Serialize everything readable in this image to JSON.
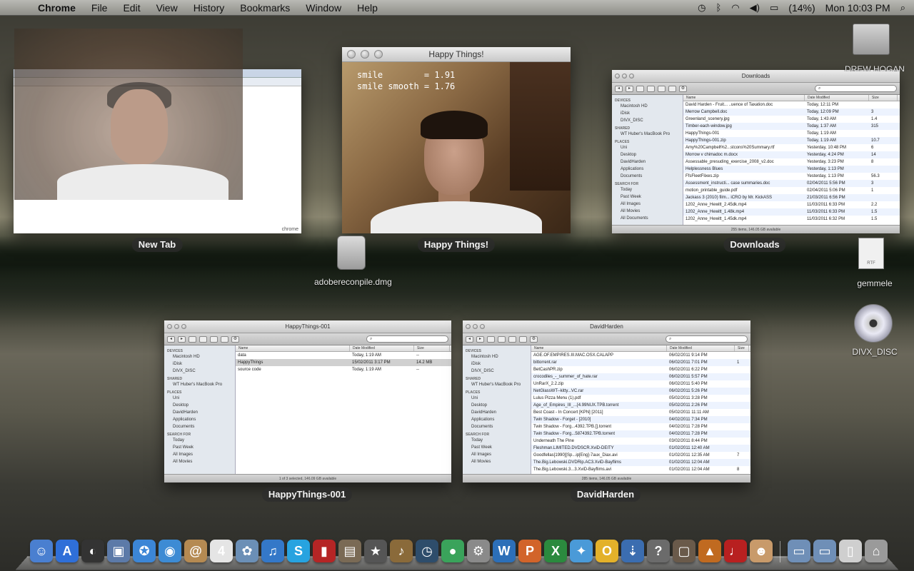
{
  "menubar": {
    "app_name": "Chrome",
    "menus": [
      "File",
      "Edit",
      "View",
      "History",
      "Bookmarks",
      "Window",
      "Help"
    ],
    "battery": "(14%)",
    "clock": "Mon 10:03 PM"
  },
  "windows": {
    "chrome": {
      "caption": "New Tab",
      "logo": "chrome"
    },
    "happy": {
      "title": "Happy Things!",
      "caption": "Happy Things!",
      "readout_line1": "smile        = 1.91",
      "readout_line2": "smile smooth = 1.76"
    },
    "downloads": {
      "title": "Downloads",
      "caption": "Downloads",
      "col_name": "Name",
      "col_date": "Date Modified",
      "col_size": "Size",
      "sidebar": [
        {
          "head": "DEVICES"
        },
        {
          "item": "Macintosh HD"
        },
        {
          "item": "iDisk"
        },
        {
          "item": "DIVX_DISC"
        },
        {
          "head": "SHARED"
        },
        {
          "item": "WT Huber's MacBook Pro"
        },
        {
          "head": "PLACES"
        },
        {
          "item": "Uni"
        },
        {
          "item": "Desktop"
        },
        {
          "item": "DavidHarden"
        },
        {
          "item": "Applications"
        },
        {
          "item": "Documents"
        },
        {
          "head": "SEARCH FOR"
        },
        {
          "item": "Today"
        },
        {
          "item": "Past Week"
        },
        {
          "item": "All Images"
        },
        {
          "item": "All Movies"
        },
        {
          "item": "All Documents"
        }
      ],
      "rows": [
        {
          "name": "David Harden - Fruit... ..uence of Taxation.doc",
          "date": "Today, 12:11 PM",
          "size": ""
        },
        {
          "name": "Merrow Campbell.doc",
          "date": "Today, 12:09 PM",
          "size": "3"
        },
        {
          "name": "Greenland_scenery.jpg",
          "date": "Today, 1:43 AM",
          "size": "1.4"
        },
        {
          "name": "Timber-each-window.jpg",
          "date": "Today, 1:37 AM",
          "size": "315"
        },
        {
          "name": "HappyThings-001",
          "date": "Today, 1:19 AM",
          "size": ""
        },
        {
          "name": "HappyThings-001.zip",
          "date": "Today, 1:19 AM",
          "size": "10.7"
        },
        {
          "name": "Amy%20Campbell%2...stcons%20Summary.rtf",
          "date": "Yesterday, 10:48 PM",
          "size": "6"
        },
        {
          "name": "Morrow v chimadoc m.docx",
          "date": "Yesterday, 4:24 PM",
          "size": "14"
        },
        {
          "name": "Assessable_presuding_exercise_2008_v2.doc",
          "date": "Yesterday, 3:23 PM",
          "size": "8"
        },
        {
          "name": "Helplessness Blues",
          "date": "Yesterday, 1:13 PM",
          "size": ""
        },
        {
          "name": "FfsFleetFlixes.zip",
          "date": "Yesterday, 1:13 PM",
          "size": "56.3"
        },
        {
          "name": "Assessment_instructi... case summaries.doc",
          "date": "02/04/2011 5:56 PM",
          "size": "3"
        },
        {
          "name": "motion_printable_guide.pdf",
          "date": "02/04/2011 5:06 PM",
          "size": "1"
        },
        {
          "name": "Jackass 3 (2010) film... iCRO by Mr. KickASS",
          "date": "21/03/2011 6:56 PM",
          "size": ""
        },
        {
          "name": "1202_Anne_Hewitt_2.45dk.mp4",
          "date": "11/03/2011 6:33 PM",
          "size": "2.2"
        },
        {
          "name": "1202_Anne_Hewitt_1.48k.mp4",
          "date": "11/03/2011 6:33 PM",
          "size": "1.5"
        },
        {
          "name": "1202_Anne_Hewitt_1.45dk.mp4",
          "date": "11/03/2011 6:32 PM",
          "size": "1.5"
        }
      ],
      "status": "255 items, 146.05 GB available"
    },
    "hthings": {
      "title": "HappyThings-001",
      "caption": "HappyThings-001",
      "col_name": "Name",
      "col_date": "Date Modified",
      "col_size": "Size",
      "sidebar": [
        {
          "head": "DEVICES"
        },
        {
          "item": "Macintosh HD"
        },
        {
          "item": "iDisk"
        },
        {
          "item": "DIVX_DISC"
        },
        {
          "head": "SHARED"
        },
        {
          "item": "WT Huber's MacBook Pro"
        },
        {
          "head": "PLACES"
        },
        {
          "item": "Uni"
        },
        {
          "item": "Desktop"
        },
        {
          "item": "DavidHarden"
        },
        {
          "item": "Applications"
        },
        {
          "item": "Documents"
        },
        {
          "head": "SEARCH FOR"
        },
        {
          "item": "Today"
        },
        {
          "item": "Past Week"
        },
        {
          "item": "All Images"
        },
        {
          "item": "All Movies"
        }
      ],
      "rows": [
        {
          "name": "data",
          "date": "Today, 1:19 AM",
          "size": "--"
        },
        {
          "name": "HappyThings",
          "date": "15/02/2011 3:17 PM",
          "size": "14.2 MB"
        },
        {
          "name": "source code",
          "date": "Today, 1:19 AM",
          "size": "--"
        }
      ],
      "status": "1 of 3 selected, 146.09 GB available"
    },
    "harden": {
      "title": "DavidHarden",
      "caption": "DavidHarden",
      "col_name": "Name",
      "col_date": "Date Modified",
      "col_size": "Size",
      "sidebar": [
        {
          "head": "DEVICES"
        },
        {
          "item": "Macintosh HD"
        },
        {
          "item": "iDisk"
        },
        {
          "item": "DIVX_DISC"
        },
        {
          "head": "SHARED"
        },
        {
          "item": "WT Huber's MacBook Pro"
        },
        {
          "head": "PLACES"
        },
        {
          "item": "Uni"
        },
        {
          "item": "Desktop"
        },
        {
          "item": "DavidHarden"
        },
        {
          "item": "Applications"
        },
        {
          "item": "Documents"
        },
        {
          "head": "SEARCH FOR"
        },
        {
          "item": "Today"
        },
        {
          "item": "Past Week"
        },
        {
          "item": "All Images"
        },
        {
          "item": "All Movies"
        }
      ],
      "rows": [
        {
          "name": "AGE.OF.EMPIRES.III.MAC.OSX.CALAPP",
          "date": "06/02/2011 9:14 PM",
          "size": ""
        },
        {
          "name": "bittorrent.rar",
          "date": "06/02/2011 7:01 PM",
          "size": "1"
        },
        {
          "name": "BetCashPR.zip",
          "date": "06/02/2011 6:22 PM",
          "size": ""
        },
        {
          "name": "crocodiles_-_summer_of_hate.rar",
          "date": "06/02/2011 5:57 PM",
          "size": ""
        },
        {
          "name": "UnRarX_2.2.zip",
          "date": "06/02/2011 5:40 PM",
          "size": ""
        },
        {
          "name": "NetGlassWT--kitty...VC.rar",
          "date": "06/02/2011 5:26 PM",
          "size": ""
        },
        {
          "name": "Lulus Pizza Menu (1).pdf",
          "date": "05/02/2011 3:28 PM",
          "size": ""
        },
        {
          "name": "Age_of_Empires_III_...[4.99NUX.TPB.torrent",
          "date": "05/02/2011 2:26 PM",
          "size": ""
        },
        {
          "name": "Best Coast - In Concert [KPN] [2011]",
          "date": "05/02/2011 11:11 AM",
          "size": ""
        },
        {
          "name": "Twin Shadow - Forget - [2010]",
          "date": "04/02/2011 7:34 PM",
          "size": ""
        },
        {
          "name": "Twin Shadow - Forg...4392.TPB.[].torrent",
          "date": "04/02/2011 7:28 PM",
          "size": ""
        },
        {
          "name": "Twin Shadow - Forg...5874392.TPB.torrent",
          "date": "04/02/2011 7:28 PM",
          "size": ""
        },
        {
          "name": "Underneath The Pine",
          "date": "03/02/2011 8:44 PM",
          "size": ""
        },
        {
          "name": "Fleshman.LIMITED.DVDSCR.XviD-DEITY",
          "date": "01/02/2011 12:40 AM",
          "size": ""
        },
        {
          "name": "Goodfellas[1990][Sp...ip[Eng]-7aux_Diax.avi",
          "date": "01/02/2011 12:35 AM",
          "size": "7"
        },
        {
          "name": "The.Big.Lebowski.DVDRip.AC3.XviD-Bayflims",
          "date": "01/02/2011 12:04 AM",
          "size": ""
        },
        {
          "name": "The.Big.Lebowski.3...3.XviD-Bayflims.avi",
          "date": "01/02/2011 12:04 AM",
          "size": "8"
        }
      ],
      "status": "285 items, 146.05 GB available"
    }
  },
  "desktop": {
    "dmg_label": "adobereconpile.dmg",
    "rtf_label": "gemmele",
    "rtf_badge": "RTF",
    "dvd_label": "DIVX_DISC",
    "dvd_badge": "DVD",
    "drive_label": "DREW HOGAN"
  },
  "dock": {
    "items": [
      {
        "name": "finder",
        "glyph": "☺",
        "color": "#4a7fd0"
      },
      {
        "name": "app-store",
        "glyph": "A",
        "color": "#2f6fd8"
      },
      {
        "name": "dashboard",
        "glyph": "◐",
        "color": "#333333"
      },
      {
        "name": "preview",
        "glyph": "▣",
        "color": "#5c7aa8"
      },
      {
        "name": "safari",
        "glyph": "✪",
        "color": "#3c86d6"
      },
      {
        "name": "ichat",
        "glyph": "◉",
        "color": "#3d8bd4"
      },
      {
        "name": "address-book",
        "glyph": "@",
        "color": "#b58a52"
      },
      {
        "name": "ical",
        "glyph": "4",
        "color": "#e5e5e5"
      },
      {
        "name": "iphoto",
        "glyph": "✿",
        "color": "#6b8fb6"
      },
      {
        "name": "itunes",
        "glyph": "♫",
        "color": "#3478c8"
      },
      {
        "name": "skype",
        "glyph": "S",
        "color": "#27a3e0"
      },
      {
        "name": "photo-booth",
        "glyph": "▮",
        "color": "#b52525"
      },
      {
        "name": "image-capture",
        "glyph": "▤",
        "color": "#7a6a55"
      },
      {
        "name": "imovie",
        "glyph": "★",
        "color": "#555555"
      },
      {
        "name": "garageband",
        "glyph": "♪",
        "color": "#8a6a3a"
      },
      {
        "name": "time-machine",
        "glyph": "◷",
        "color": "#2e4d6b"
      },
      {
        "name": "chrome",
        "glyph": "●",
        "color": "#3aa35b"
      },
      {
        "name": "system-preferences",
        "glyph": "⚙",
        "color": "#8a8a8a"
      },
      {
        "name": "word",
        "glyph": "W",
        "color": "#2c6fb8"
      },
      {
        "name": "powerpoint",
        "glyph": "P",
        "color": "#d2642a"
      },
      {
        "name": "excel",
        "glyph": "X",
        "color": "#2b8a3e"
      },
      {
        "name": "messenger",
        "glyph": "✦",
        "color": "#4a9ad8"
      },
      {
        "name": "entourage",
        "glyph": "O",
        "color": "#e3b12a"
      },
      {
        "name": "transmission",
        "glyph": "⇣",
        "color": "#3b6db0"
      },
      {
        "name": "help",
        "glyph": "?",
        "color": "#6b6b6b"
      },
      {
        "name": "photo-slideshow",
        "glyph": "▢",
        "color": "#6a5a4a"
      },
      {
        "name": "campfire",
        "glyph": "▲",
        "color": "#c06a20"
      },
      {
        "name": "piano",
        "glyph": "♩",
        "color": "#b82020"
      },
      {
        "name": "cat",
        "glyph": "☻",
        "color": "#c89a6a"
      }
    ],
    "stacks": [
      {
        "name": "applications-stack",
        "glyph": "▭",
        "color": "#6f8fb7"
      },
      {
        "name": "documents-stack",
        "glyph": "▭",
        "color": "#6f8fb7"
      },
      {
        "name": "downloads-stack",
        "glyph": "▯",
        "color": "#cfcfcf"
      },
      {
        "name": "trash",
        "glyph": "⌂",
        "color": "#9a9a9a"
      }
    ]
  }
}
